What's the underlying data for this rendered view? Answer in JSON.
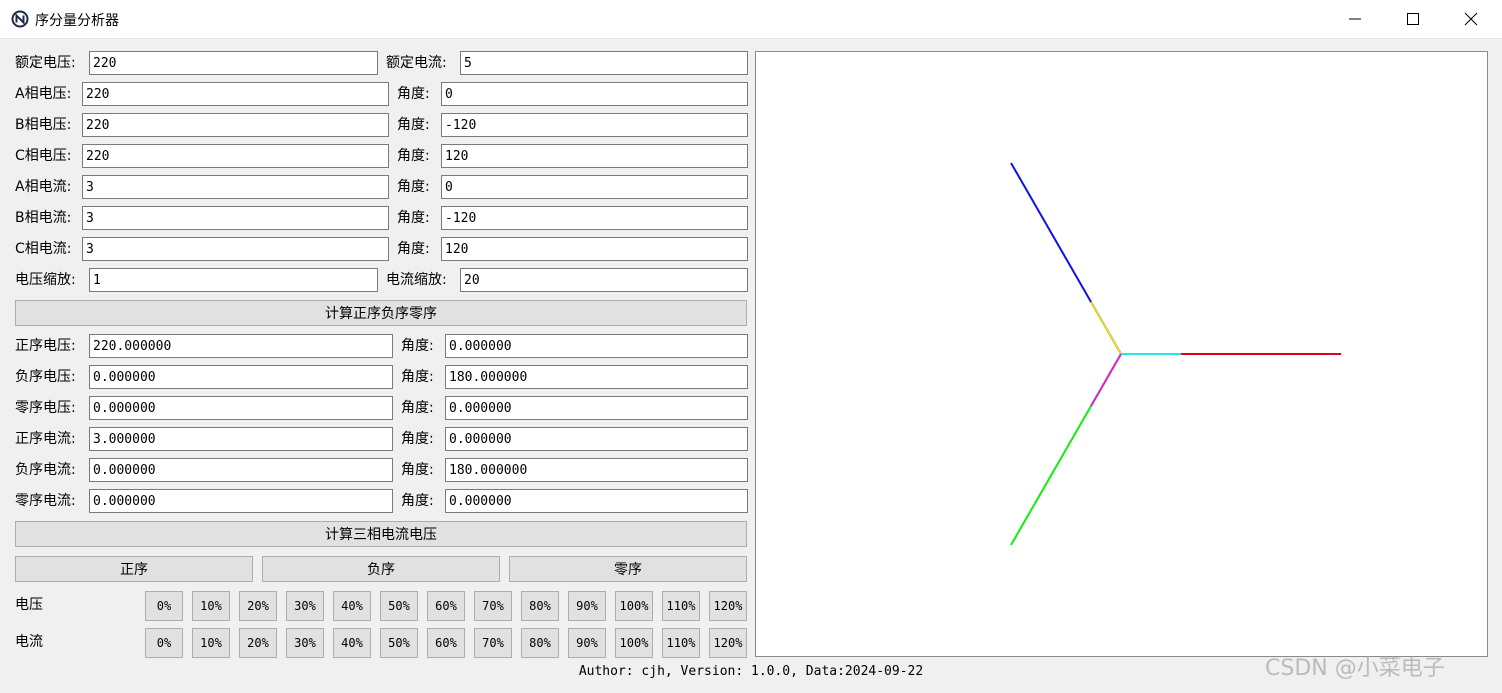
{
  "window": {
    "title": "序分量分析器",
    "icon": "circled-n-icon",
    "controls": [
      "minimize-icon",
      "maximize-icon",
      "close-icon"
    ]
  },
  "rated": {
    "voltage_label": "额定电压:",
    "voltage_value": "220",
    "current_label": "额定电流:",
    "current_value": "5"
  },
  "phases": [
    {
      "label": "A相电压:",
      "value": "220",
      "angle_label": "角度:",
      "angle": "0"
    },
    {
      "label": "B相电压:",
      "value": "220",
      "angle_label": "角度:",
      "angle": "-120"
    },
    {
      "label": "C相电压:",
      "value": "220",
      "angle_label": "角度:",
      "angle": "120"
    },
    {
      "label": "A相电流:",
      "value": "3",
      "angle_label": "角度:",
      "angle": "0"
    },
    {
      "label": "B相电流:",
      "value": "3",
      "angle_label": "角度:",
      "angle": "-120"
    },
    {
      "label": "C相电流:",
      "value": "3",
      "angle_label": "角度:",
      "angle": "120"
    }
  ],
  "scale": {
    "voltage_label": "电压缩放:",
    "voltage_value": "1",
    "current_label": "电流缩放:",
    "current_value": "20"
  },
  "calc_sequence_button": "计算正序负序零序",
  "sequences": [
    {
      "label": "正序电压:",
      "value": "220.000000",
      "angle_label": "角度:",
      "angle": "0.000000"
    },
    {
      "label": "负序电压:",
      "value": "0.000000",
      "angle_label": "角度:",
      "angle": "180.000000"
    },
    {
      "label": "零序电压:",
      "value": "0.000000",
      "angle_label": "角度:",
      "angle": "0.000000"
    },
    {
      "label": "正序电流:",
      "value": "3.000000",
      "angle_label": "角度:",
      "angle": "0.000000"
    },
    {
      "label": "负序电流:",
      "value": "0.000000",
      "angle_label": "角度:",
      "angle": "180.000000"
    },
    {
      "label": "零序电流:",
      "value": "0.000000",
      "angle_label": "角度:",
      "angle": "0.000000"
    }
  ],
  "calc_three_phase_button": "计算三相电流电压",
  "mode_buttons": [
    "正序",
    "负序",
    "零序"
  ],
  "voltage_row_label": "电压",
  "current_row_label": "电流",
  "percent_buttons": [
    "0%",
    "10%",
    "20%",
    "30%",
    "40%",
    "50%",
    "60%",
    "70%",
    "80%",
    "90%",
    "100%",
    "110%",
    "120%"
  ],
  "phasor_plot": {
    "scale_note": "current drawn with 电流缩放 factor",
    "colors": {
      "voltage_a": "#e0001a",
      "voltage_b": "#1010e8",
      "voltage_c": "#11ee11",
      "current_a": "#22e8e8",
      "current_b": "#e8d828",
      "current_c": "#e020d8"
    }
  },
  "footer": "Author: cjh, Version: 1.0.0, Data:2024-09-22",
  "watermark": "CSDN @小菜电子"
}
